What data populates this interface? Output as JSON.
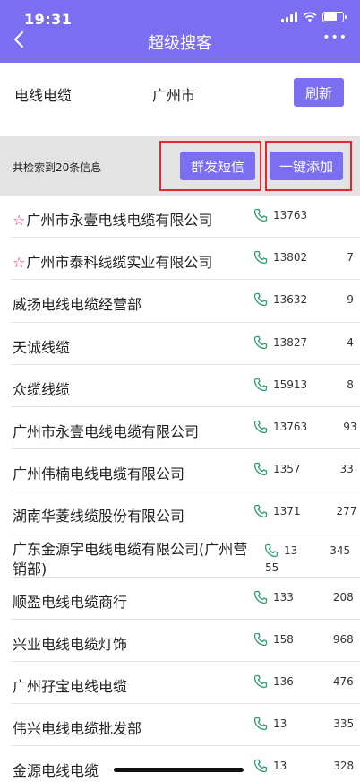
{
  "status_bar": {
    "time": "19:31"
  },
  "header": {
    "title": "超级搜客",
    "more": "•••"
  },
  "query": {
    "keyword": "电线电缆",
    "city": "广州市",
    "refresh_label": "刷新"
  },
  "summary": {
    "text": "共检索到20条信息",
    "mass_sms_label": "群发短信",
    "add_all_label": "一键添加"
  },
  "results": [
    {
      "name": "广州市永壹电线电缆有限公司",
      "phone": "13763",
      "starred": true
    },
    {
      "name": "广州市泰科线缆实业有限公司",
      "phone": "13802",
      "phone_tail": "7",
      "starred": true
    },
    {
      "name": "威扬电线电缆经营部",
      "phone": "13632",
      "phone_tail": "9"
    },
    {
      "name": "天诚线缆",
      "phone": "13827",
      "phone_tail": "4"
    },
    {
      "name": "众缆线缆",
      "phone": "15913",
      "phone_tail": "8"
    },
    {
      "name": "广州市永壹电线电缆有限公司",
      "phone": "13763",
      "phone_tail": "93"
    },
    {
      "name": "广州伟楠电线电缆有限公司",
      "phone": "1357",
      "phone_tail": "33"
    },
    {
      "name": "湖南华菱线缆股份有限公司",
      "phone": "1371",
      "phone_tail": "277"
    },
    {
      "name": "广东金源宇电线电缆有限公司(广州营销部)",
      "phone": "13",
      "phone_tail": "345",
      "phone_line2": "55"
    },
    {
      "name": "顺盈电线电缆商行",
      "phone": "133",
      "phone_tail": "208"
    },
    {
      "name": "兴业电线电缆灯饰",
      "phone": "158",
      "phone_tail": "968"
    },
    {
      "name": "广州孖宝电线电缆",
      "phone": "136",
      "phone_tail": "476"
    },
    {
      "name": "伟兴电线电缆批发部",
      "phone": "13",
      "phone_tail": "335"
    },
    {
      "name": "金源电线电缆",
      "phone": "13",
      "phone_tail": "328"
    }
  ],
  "colors": {
    "accent": "#7b6ef0",
    "highlight_border": "#e0282e",
    "star": "#e8336a",
    "phone_icon": "#2a9d6a"
  }
}
